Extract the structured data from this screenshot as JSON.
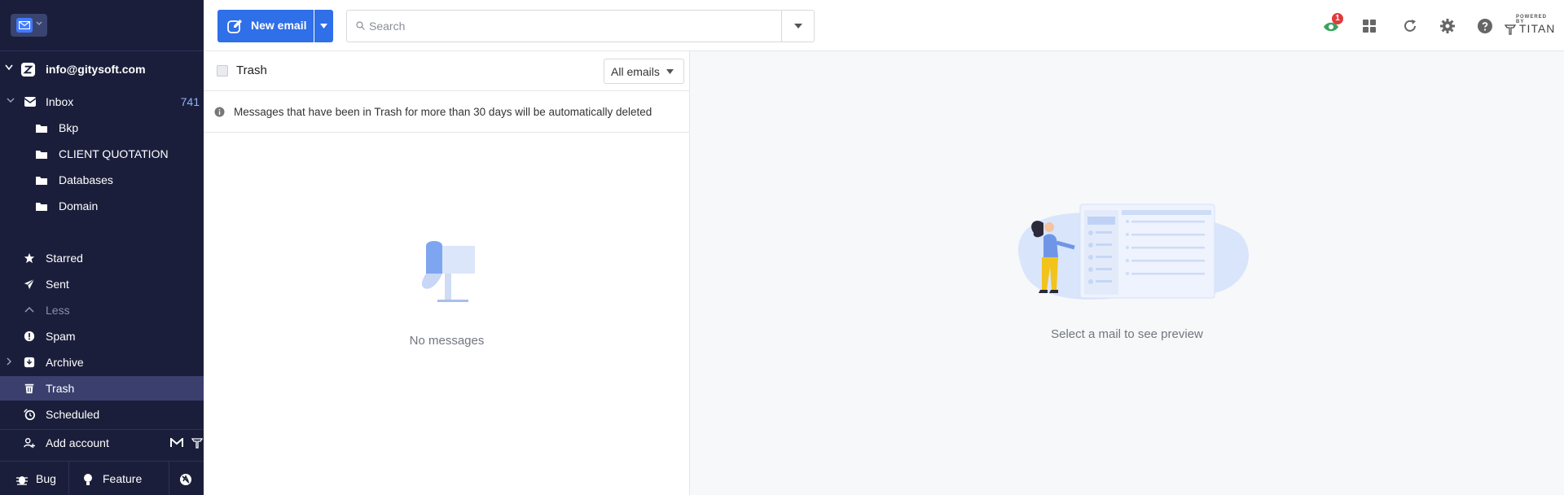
{
  "sidebar": {
    "account_email": "info@gitysoft.com",
    "folders": [
      {
        "label": "Inbox",
        "count": "741",
        "icon": "inbox-icon"
      },
      {
        "label": "Bkp",
        "icon": "folder-icon"
      },
      {
        "label": "CLIENT QUOTATION",
        "icon": "folder-icon"
      },
      {
        "label": "Databases",
        "icon": "folder-icon"
      },
      {
        "label": "Domain",
        "icon": "folder-icon"
      }
    ],
    "system": [
      {
        "label": "Starred",
        "icon": "star-icon"
      },
      {
        "label": "Sent",
        "icon": "send-icon"
      },
      {
        "label": "Less",
        "icon": "chevron-up-icon"
      },
      {
        "label": "Spam",
        "icon": "alert-icon"
      },
      {
        "label": "Archive",
        "icon": "archive-icon"
      },
      {
        "label": "Trash",
        "icon": "trash-icon",
        "active": true
      },
      {
        "label": "Scheduled",
        "icon": "clock-icon"
      }
    ],
    "add_account": "Add account",
    "bottom": {
      "bug": "Bug",
      "feature": "Feature"
    }
  },
  "toolbar": {
    "new_email": "New email",
    "search_placeholder": "Search",
    "notification_count": "1",
    "powered_by": "POWERED BY",
    "brand": "TITAN"
  },
  "list": {
    "title": "Trash",
    "filter": "All emails",
    "notice": "Messages that have been in Trash for more than 30 days will be automatically deleted",
    "empty": "No messages"
  },
  "preview": {
    "empty": "Select a mail to see preview"
  },
  "colors": {
    "sidebar_bg": "#1b1e3b",
    "accent": "#2f6fe8",
    "active_item": "#3a3f6e",
    "badge": "#e23a3a"
  }
}
